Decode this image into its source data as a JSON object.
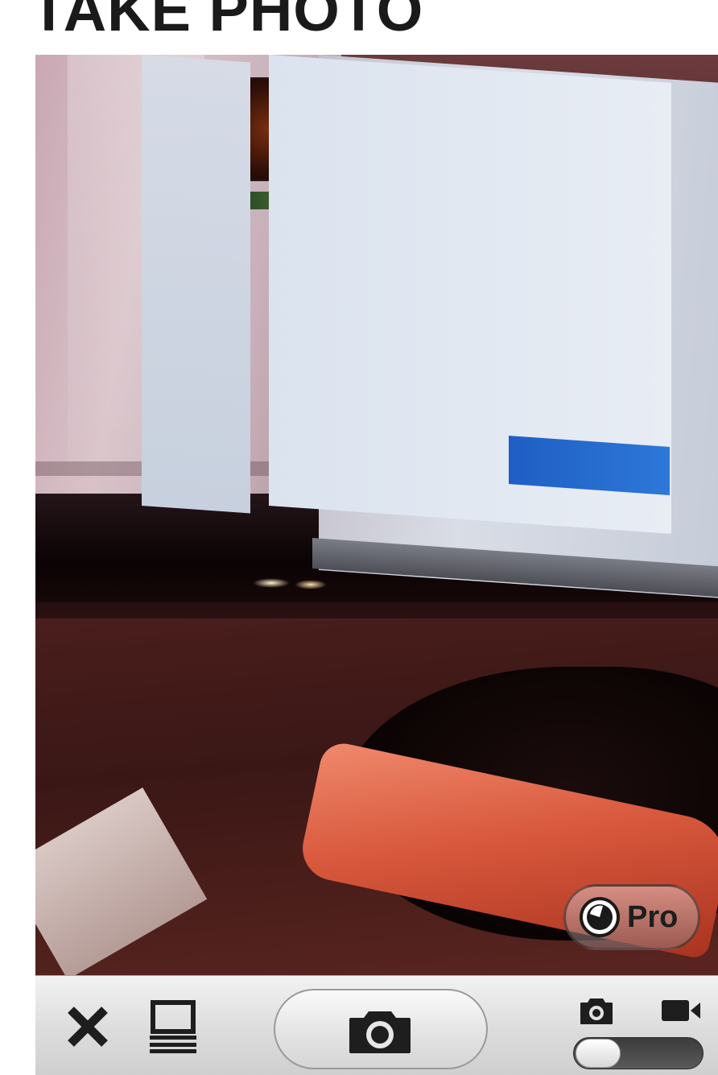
{
  "header": {
    "title": "TAKE PHOTO"
  },
  "camera": {
    "pro_badge_label": "Pro",
    "capture_mode": "photo"
  },
  "toolbar": {
    "close_icon": "close-icon",
    "gallery_icon": "photo-library-icon",
    "shutter_icon": "camera-icon",
    "photo_mode_icon": "camera-icon",
    "video_mode_icon": "video-camera-icon"
  },
  "colors": {
    "toolbar_top": "#f2f2f2",
    "toolbar_bottom": "#cfcfcf",
    "icon": "#1e1e1e",
    "toggle_track": "#4a4a4a"
  }
}
